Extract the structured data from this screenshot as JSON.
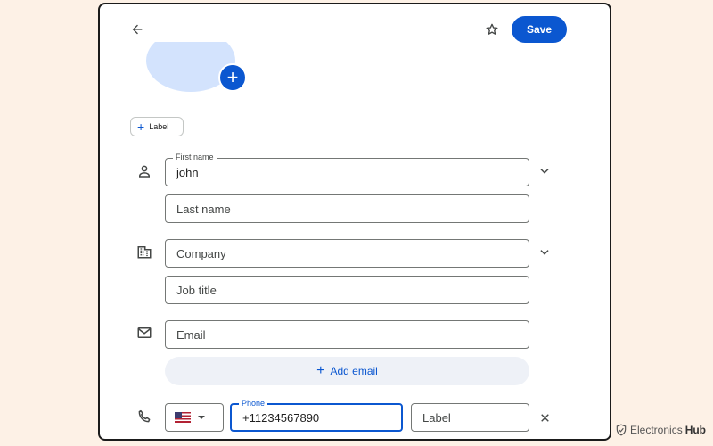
{
  "toolbar": {
    "back_icon": "arrow-left-icon",
    "star_icon": "star-outline-icon",
    "save_label": "Save"
  },
  "photo": {
    "add_icon": "plus-icon",
    "add_symbol": "+"
  },
  "label_chip": {
    "icon": "plus-icon",
    "symbol": "+",
    "text": "Label"
  },
  "name": {
    "icon": "person-icon",
    "first_name_label": "First name",
    "first_name_value": "john",
    "last_name_placeholder": "Last name"
  },
  "company": {
    "icon": "building-icon",
    "company_placeholder": "Company",
    "job_title_placeholder": "Job title"
  },
  "email": {
    "icon": "mail-icon",
    "placeholder": "Email",
    "add_symbol": "+",
    "add_label": "Add email"
  },
  "phone": {
    "icon": "phone-icon",
    "country_flag": "us-flag-icon",
    "field_label": "Phone",
    "value": "+11234567890",
    "label_placeholder": "Label",
    "remove_icon": "close-icon"
  },
  "colors": {
    "accent": "#0b57d0",
    "avatar": "#d3e3fd",
    "page_bg": "#fdf1e6"
  },
  "watermark": {
    "brand": "Electronics",
    "hub": "Hub"
  }
}
